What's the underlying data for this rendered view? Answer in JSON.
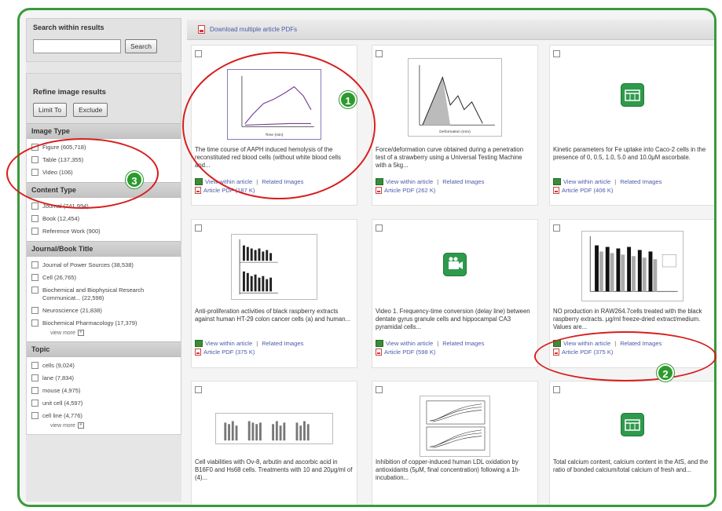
{
  "sidebar": {
    "search_title": "Search within results",
    "search_button": "Search",
    "refine_title": "Refine image results",
    "limit_button": "Limit To",
    "exclude_button": "Exclude",
    "sections": [
      {
        "title": "Image Type",
        "items": [
          "Figure (605,718)",
          "Table (137,355)",
          "Video (106)"
        ]
      },
      {
        "title": "Content Type",
        "items": [
          "Journal (741,994)",
          "Book (12,454)",
          "Reference Work (900)"
        ]
      },
      {
        "title": "Journal/Book Title",
        "items": [
          "Journal of Power Sources (38,538)",
          "Cell (26,765)",
          "Biochemical and Biophysical Research Communicat... (22,598)",
          "Neuroscience (21,838)",
          "Biochemical Pharmacology (17,379)"
        ],
        "view_more": "view more"
      },
      {
        "title": "Topic",
        "items": [
          "cells (9,024)",
          "lane (7,834)",
          "mouse (4,975)",
          "unit cell (4,597)",
          "cell line (4,776)"
        ],
        "view_more": "view more"
      }
    ]
  },
  "topbar": {
    "download_label": "Download multiple article PDFs"
  },
  "cards": [
    {
      "caption": "The time course of AAPH induced hemolysis of the reconstituted red blood cells (without white blood cells and...",
      "view": "View within article",
      "related": "Related Images",
      "pdf": "Article PDF (187 K)"
    },
    {
      "caption": "Force/deformation curve obtained during a penetration test of a strawberry using a Universal Testing Machine with a 5kg...",
      "view": "View within article",
      "related": "Related Images",
      "pdf": "Article PDF (262 K)"
    },
    {
      "caption": "Kinetic parameters for Fe uptake into Caco-2 cells in the presence of 0, 0.5, 1.0, 5.0 and 10.0μM ascorbate.",
      "view": "View within article",
      "related": "Related Images",
      "pdf": "Article PDF (406 K)"
    },
    {
      "caption": "Anti-proliferation activities of black raspberry extracts against human HT-29 colon cancer cells (a) and human...",
      "view": "View within article",
      "related": "Related Images",
      "pdf": "Article PDF (375 K)"
    },
    {
      "caption": "Video 1. Frequency-time conversion (delay line) between dentate gyrus granule cells and hippocampal CA3 pyramidal cells...",
      "view": "View within article",
      "related": "Related Images",
      "pdf": "Article PDF (598 K)"
    },
    {
      "caption": "NO production in RAW264.7cells treated with the black raspberry extracts. μg/ml freeze-dried extract/medium. Values are...",
      "view": "View within article",
      "related": "Related Images",
      "pdf": "Article PDF (375 K)"
    },
    {
      "caption": "Cell viabilities with Ov-8, arbutin and ascorbic acid in B16F0 and Hs68 cells. Treatments with 10 and 20μg/ml of (4)...",
      "view": "",
      "related": "",
      "pdf": ""
    },
    {
      "caption": "Inhibition of copper-induced human LDL oxidation by antioxidants (5μM, final concentration) following a 1h-incubation...",
      "view": "",
      "related": "",
      "pdf": ""
    },
    {
      "caption": "Total calcium content, calcium content in the AtS, and the ratio of bonded calcium/total calcium of fresh and...",
      "view": "",
      "related": "",
      "pdf": ""
    }
  ],
  "callouts": [
    "1",
    "2",
    "3"
  ],
  "colors": {
    "frame": "#3a9a3a",
    "callout_oval": "#d81e1e",
    "callout_badge": "#2d9a2d",
    "link": "#4b5aa8"
  }
}
